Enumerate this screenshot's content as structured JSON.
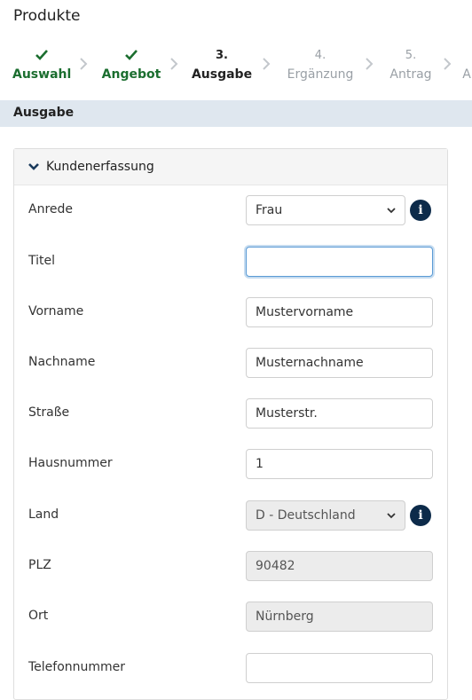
{
  "page": {
    "title": "Produkte"
  },
  "stepper": {
    "steps": [
      {
        "num": "✔",
        "label": "Auswahl",
        "state": "done"
      },
      {
        "num": "✔",
        "label": "Angebot",
        "state": "done"
      },
      {
        "num": "3.",
        "label": "Ausgabe",
        "state": "active"
      },
      {
        "num": "4.",
        "label": "Ergänzung",
        "state": "todo"
      },
      {
        "num": "5.",
        "label": "Antrag",
        "state": "todo"
      },
      {
        "num": "",
        "label": "A",
        "state": "todo"
      }
    ]
  },
  "section": {
    "title": "Ausgabe"
  },
  "panel": {
    "title": "Kundenerfassung",
    "fields": [
      {
        "label": "Anrede",
        "type": "select",
        "value": "Frau",
        "info": true
      },
      {
        "label": "Titel",
        "type": "input",
        "value": "",
        "focused": true
      },
      {
        "label": "Vorname",
        "type": "input",
        "value": "Mustervorname"
      },
      {
        "label": "Nachname",
        "type": "input",
        "value": "Musternachname"
      },
      {
        "label": "Straße",
        "type": "input",
        "value": "Musterstr."
      },
      {
        "label": "Hausnummer",
        "type": "input",
        "value": "1"
      },
      {
        "label": "Land",
        "type": "select",
        "value": "D - Deutschland",
        "info": true
      },
      {
        "label": "PLZ",
        "type": "input",
        "value": "90482",
        "disabled": true
      },
      {
        "label": "Ort",
        "type": "input",
        "value": "Nürnberg",
        "disabled": true
      },
      {
        "label": "Telefonnummer",
        "type": "input",
        "value": ""
      }
    ]
  },
  "colors": {
    "done": "#1b6e2f",
    "todo": "#9aa0a6",
    "section_bg": "#dfe7ef",
    "info_bg": "#0d2b4a"
  }
}
